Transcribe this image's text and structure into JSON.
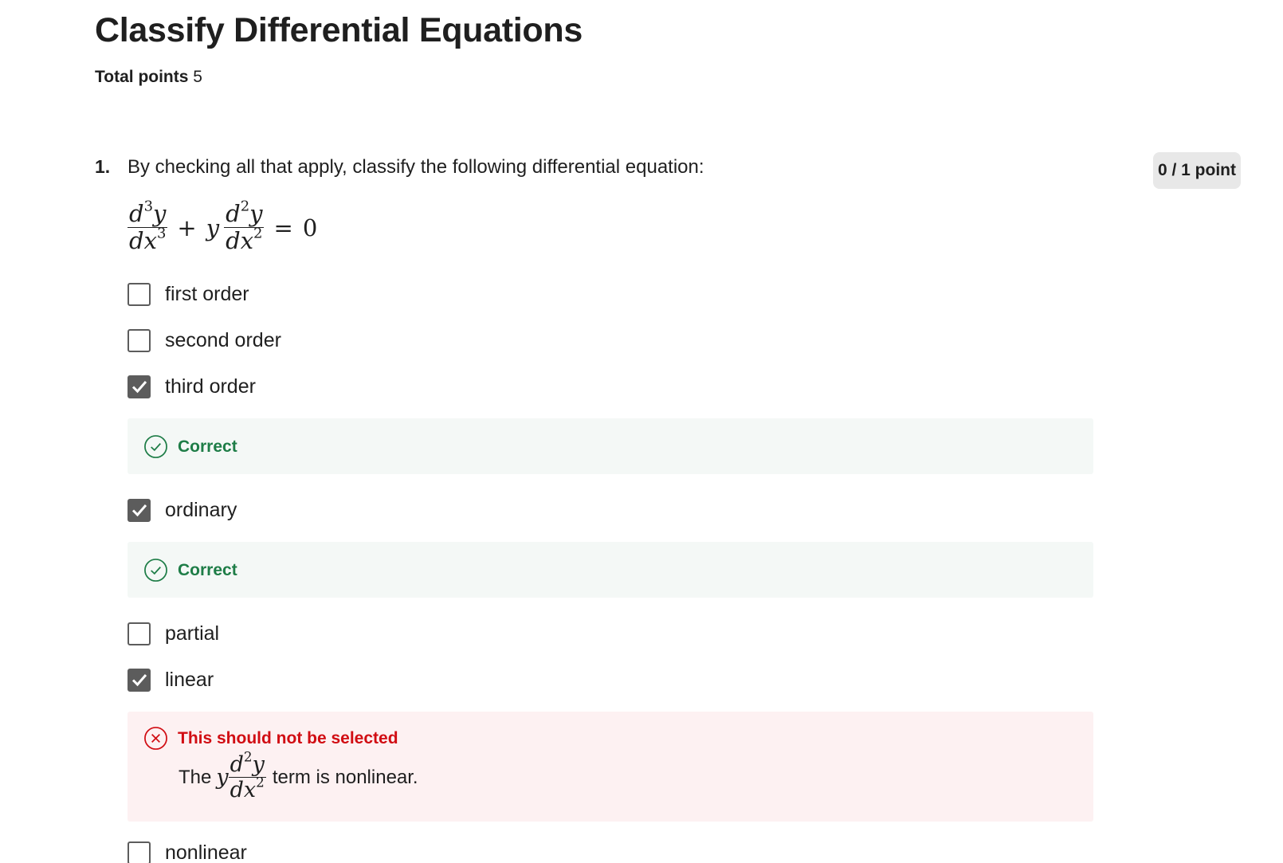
{
  "page": {
    "title": "Classify Differential Equations",
    "total_points_label": "Total points",
    "total_points_value": "5"
  },
  "question": {
    "number": "1.",
    "text": "By checking all that apply, classify the following differential equation:",
    "score": "0 / 1 point",
    "equation": {
      "term1_num_d": "d",
      "term1_num_exp": "3",
      "term1_num_var": "y",
      "term1_den_base": "dx",
      "term1_den_exp": "3",
      "plus": "+",
      "coef": "y",
      "term2_num_d": "d",
      "term2_num_exp": "2",
      "term2_num_var": "y",
      "term2_den_base": "dx",
      "term2_den_exp": "2",
      "equals": "=",
      "rhs": "0"
    },
    "options": [
      {
        "label": "first order",
        "checked": false
      },
      {
        "label": "second order",
        "checked": false
      },
      {
        "label": "third order",
        "checked": true
      },
      {
        "label": "ordinary",
        "checked": true
      },
      {
        "label": "partial",
        "checked": false
      },
      {
        "label": "linear",
        "checked": true
      },
      {
        "label": "nonlinear",
        "checked": false
      }
    ],
    "feedback": {
      "third_order": {
        "status": "Correct"
      },
      "ordinary": {
        "status": "Correct"
      },
      "linear": {
        "status": "This should not be selected",
        "explanation_prefix": "The",
        "explanation_coef": "y",
        "explanation_num_d": "d",
        "explanation_num_exp": "2",
        "explanation_num_var": "y",
        "explanation_den_base": "dx",
        "explanation_den_exp": "2",
        "explanation_suffix": "term is nonlinear."
      }
    }
  },
  "colors": {
    "correct": "#1e7d47",
    "correct_bg": "#f4f8f6",
    "incorrect": "#d10d13",
    "incorrect_bg": "#fdf1f2",
    "checkbox": "#5c5c5c",
    "badge_bg": "#e8e8e8"
  },
  "icons": {
    "checked": "checkmark-icon",
    "correct": "check-circle-icon",
    "incorrect": "x-circle-icon"
  }
}
